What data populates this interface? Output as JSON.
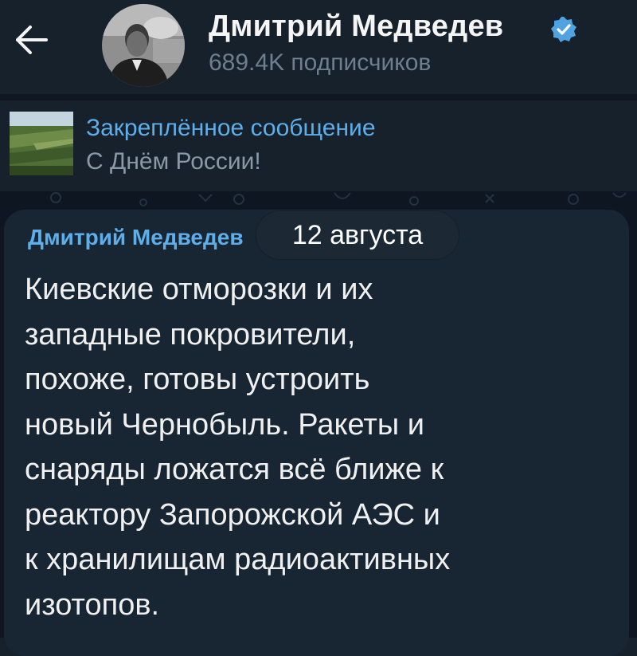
{
  "header": {
    "channel_name": "Дмитрий Медведев",
    "subscribers": "689.4K подписчиков",
    "back_icon": "arrow-left-icon",
    "verified_icon": "verified-badge-icon"
  },
  "pinned": {
    "title": "Закреплённое сообщение",
    "text": "С Днём России!"
  },
  "message": {
    "author": "Дмитрий Медведев",
    "date": "12 августа",
    "lines": [
      "Киевские отморозки и их",
      "западные покровители,",
      "похоже, готовы устроить",
      "новый Чернобыль. Ракеты и",
      "снаряды ложатся всё ближе к",
      "реактору Запорожской АЭС и",
      "к хранилищам радиоактивных",
      "изотопов."
    ]
  },
  "colors": {
    "background": "#17212b",
    "chat_background": "#0e1621",
    "bubble": "#182533",
    "accent": "#5eaee9",
    "verified": "#4fa3e0"
  }
}
